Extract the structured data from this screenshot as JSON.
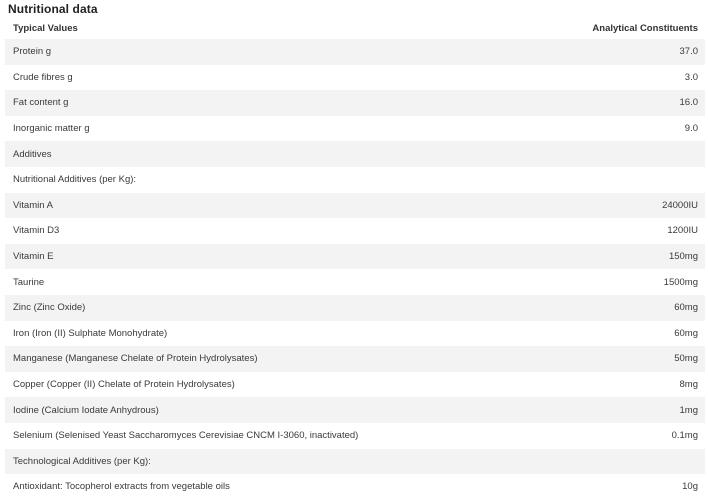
{
  "title": "Nutritional data",
  "header": {
    "left": "Typical Values",
    "right": "Analytical Constituents"
  },
  "rows": [
    {
      "label": "Protein g",
      "value": "37.0"
    },
    {
      "label": "Crude fibres g",
      "value": "3.0"
    },
    {
      "label": "Fat content g",
      "value": "16.0"
    },
    {
      "label": "Inorganic matter g",
      "value": "9.0"
    },
    {
      "label": "Additives",
      "value": ""
    },
    {
      "label": "Nutritional Additives (per Kg):",
      "value": ""
    },
    {
      "label": "Vitamin A",
      "value": "24000IU"
    },
    {
      "label": "Vitamin D3",
      "value": "1200IU"
    },
    {
      "label": "Vitamin E",
      "value": "150mg"
    },
    {
      "label": "Taurine",
      "value": "1500mg"
    },
    {
      "label": "Zinc (Zinc Oxide)",
      "value": "60mg"
    },
    {
      "label": "Iron (Iron (II) Sulphate Monohydrate)",
      "value": "60mg"
    },
    {
      "label": "Manganese (Manganese Chelate of Protein Hydrolysates)",
      "value": "50mg"
    },
    {
      "label": "Copper (Copper (II) Chelate of Protein Hydrolysates)",
      "value": "8mg"
    },
    {
      "label": "Iodine (Calcium Iodate Anhydrous)",
      "value": "1mg"
    },
    {
      "label": "Selenium (Selenised Yeast Saccharomyces Cerevisiae CNCM I-3060, inactivated)",
      "value": "0.1mg"
    },
    {
      "label": "Technological Additives (per Kg):",
      "value": ""
    },
    {
      "label": "Antioxidant: Tocopherol extracts from vegetable oils",
      "value": "10g"
    }
  ]
}
